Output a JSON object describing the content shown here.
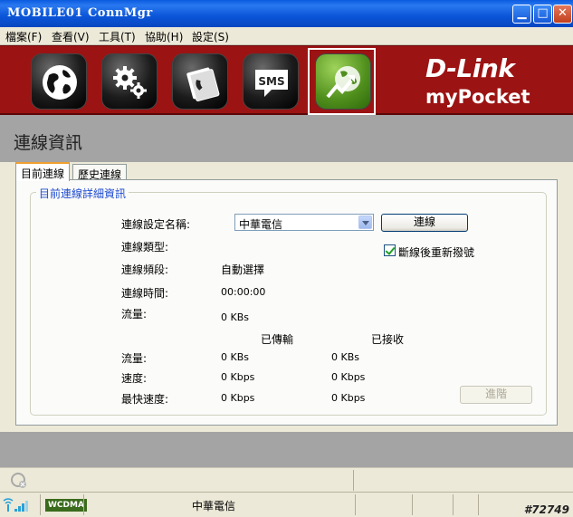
{
  "window": {
    "title": "MOBILE01 ConnMgr"
  },
  "menu": [
    {
      "label": "檔案(F)"
    },
    {
      "label": "查看(V)"
    },
    {
      "label": "工具(T)"
    },
    {
      "label": "協助(H)"
    },
    {
      "label": "設定(S)"
    }
  ],
  "toolbar": {
    "sms_label": "SMS",
    "brand_name": "D-Link",
    "brand_product": "myPocket"
  },
  "page": {
    "title": "連線資訊"
  },
  "tabs": [
    {
      "label": "目前連線"
    },
    {
      "label": "歷史連線"
    }
  ],
  "details": {
    "group_title": "目前連線詳細資訊",
    "profile_label": "連線設定名稱:",
    "profile_value": "中華電信",
    "connect_button": "連線",
    "auto_reconnect_label": "斷線後重新撥號",
    "type_label": "連線類型:",
    "band_label": "連線頻段:",
    "band_value": "自動選擇",
    "time_label": "連線時間:",
    "time_value": "00:00:00",
    "traffic_label": "流量:",
    "traffic_value": "0 KBs",
    "sent_header": "已傳輸",
    "recv_header": "已接收",
    "rows": [
      {
        "label": "流量:",
        "sent": "0 KBs",
        "recv": "0 KBs"
      },
      {
        "label": "速度:",
        "sent": "0 Kbps",
        "recv": "0 Kbps"
      },
      {
        "label": "最快速度:",
        "sent": "0 Kbps",
        "recv": "0 Kbps"
      }
    ],
    "advanced_button": "進階"
  },
  "status": {
    "network_type": "WCDMA",
    "operator": "中華電信",
    "watermark": "#72749"
  },
  "colors": {
    "banner": "#9c1313",
    "accent_green": "#5a9a20",
    "group_title": "#1e4bd0"
  }
}
